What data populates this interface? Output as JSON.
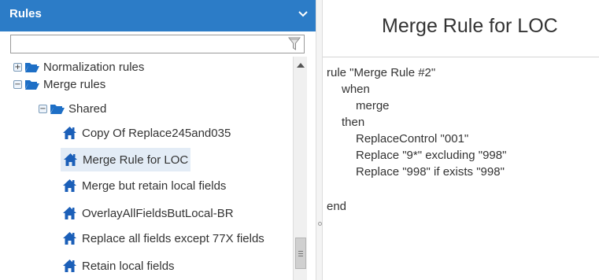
{
  "left_panel": {
    "title": "Rules",
    "collapse_icon": "chevron-down-icon",
    "filter": {
      "value": "",
      "placeholder": "",
      "icon": "funnel-filter-icon"
    },
    "tree": [
      {
        "label": "Normalization rules",
        "expander": "+",
        "icon": "folder-open-icon",
        "level": 0
      },
      {
        "label": "Merge rules",
        "expander": "−",
        "icon": "folder-open-icon",
        "level": 0
      },
      {
        "label": "Shared",
        "expander": "−",
        "icon": "folder-open-icon",
        "level": 1
      },
      {
        "label": "Copy Of Replace245and035",
        "icon": "home-icon",
        "level": 2
      },
      {
        "label": "Merge Rule for LOC",
        "icon": "home-icon",
        "level": 2,
        "selected": true
      },
      {
        "label": "Merge but retain local fields",
        "icon": "home-icon",
        "level": 2
      },
      {
        "label": "OverlayAllFieldsButLocal-BR",
        "icon": "home-icon",
        "level": 2
      },
      {
        "label": "Replace all fields except 77X fields",
        "icon": "home-icon",
        "level": 2
      },
      {
        "label": "Retain local fields",
        "icon": "home-icon",
        "level": 2
      }
    ]
  },
  "right_panel": {
    "title": "Merge Rule for LOC",
    "rule_lines": [
      "rule \"Merge Rule #2\"",
      "when",
      "merge",
      "then",
      "ReplaceControl \"001\"",
      "Replace \"9*\" excluding \"998\"",
      "Replace \"998\" if exists \"998\"",
      "end"
    ]
  },
  "colors": {
    "header_bg": "#2c7cc7",
    "folder_blue": "#1e6fc6",
    "home_blue": "#1b5fb8",
    "selected_bg": "#e3ecf6"
  }
}
